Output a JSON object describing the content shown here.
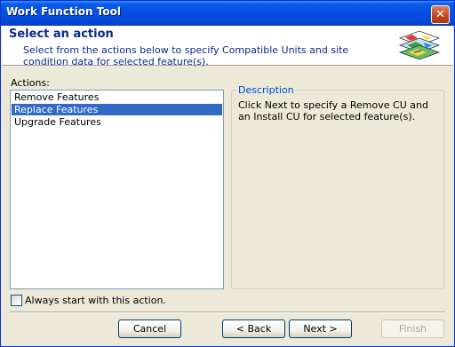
{
  "window": {
    "title": "Work Function Tool"
  },
  "header": {
    "title": "Select an action",
    "description": "Select from the actions below to specify Compatible Units and site condition data for selected feature(s).",
    "icon": "map-layers-icon"
  },
  "actions": {
    "label": "Actions:",
    "items": [
      {
        "label": "Remove Features",
        "selected": false
      },
      {
        "label": "Replace Features",
        "selected": true
      },
      {
        "label": "Upgrade Features",
        "selected": false
      }
    ]
  },
  "description_group": {
    "legend": "Description",
    "text": "Click Next to specify a Remove CU and an Install CU for selected feature(s)."
  },
  "always_start": {
    "label": "Always start with this action.",
    "checked": false
  },
  "buttons": {
    "cancel": "Cancel",
    "back": "< Back",
    "next": "Next >",
    "finish": "Finish",
    "finish_enabled": false
  },
  "colors": {
    "titlebar": "#0551e3",
    "selection": "#316ac5",
    "header_text": "#0b2a8c",
    "legend_text": "#0046d5"
  }
}
